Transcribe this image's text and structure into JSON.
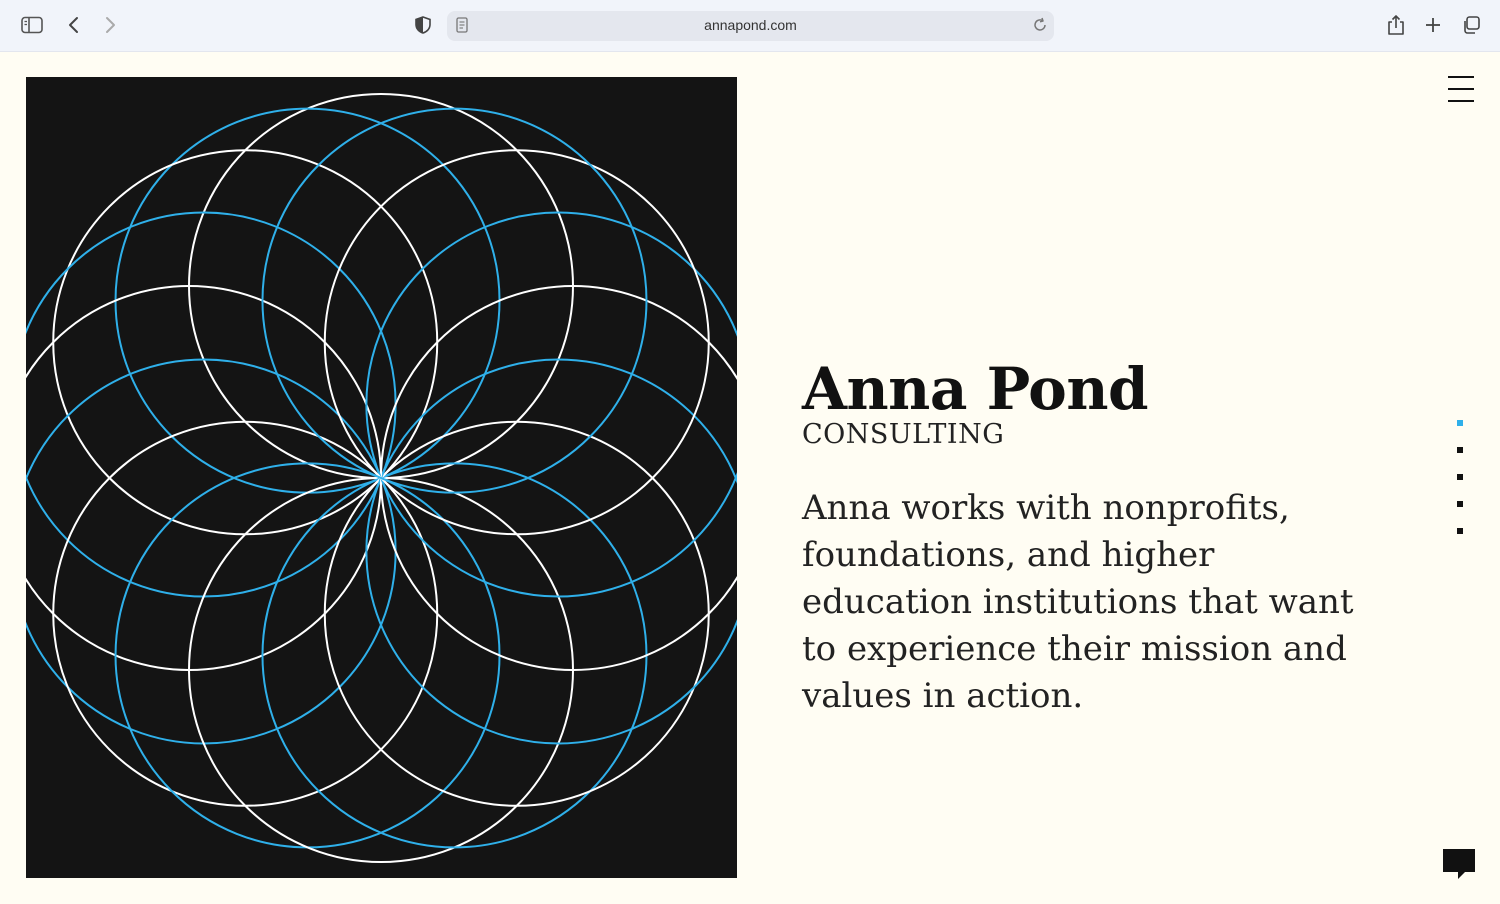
{
  "browser": {
    "url": "annapond.com"
  },
  "hero": {
    "name": "Anna Pond",
    "subtitle": "CONSULTING",
    "blurb": "Anna works with nonprofits, foundations, and higher education institutions that want to experience their mission and values in action."
  },
  "art": {
    "background": "#141414",
    "colors": [
      "#ffffff",
      "#2fb0ea"
    ]
  },
  "side_nav": {
    "dots": 5,
    "active_index": 0,
    "active_color": "#2fb0ea"
  },
  "icons": {
    "sidebar": "sidebar-icon",
    "back": "chevron-left-icon",
    "forward": "chevron-right-icon",
    "privacy": "shield-icon",
    "reader": "page-icon",
    "reload": "reload-icon",
    "share": "share-icon",
    "new_tab": "plus-icon",
    "tabs": "tabs-icon",
    "menu": "hamburger-icon",
    "chat": "chat-icon"
  }
}
